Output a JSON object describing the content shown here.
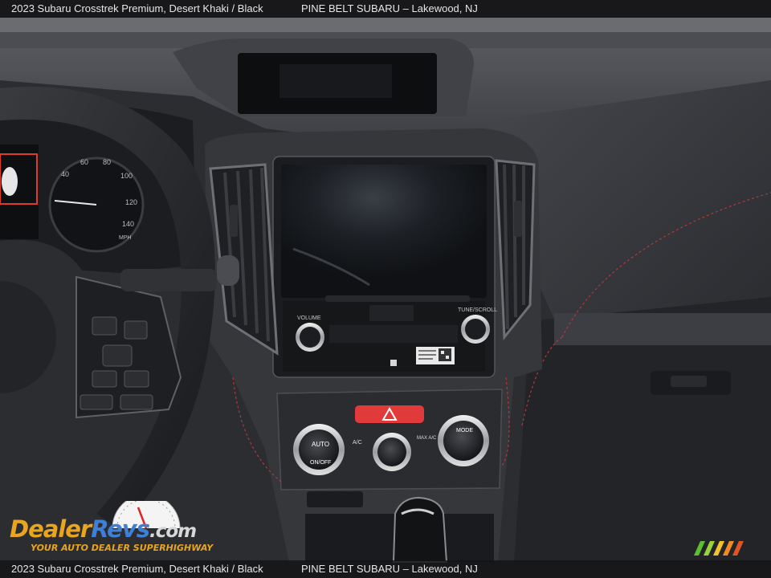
{
  "caption": {
    "vehicle": "2023 Subaru Crosstrek Premium,  Desert Khaki / Black",
    "dealer": "PINE BELT SUBARU – Lakewood, NJ"
  },
  "dashboard": {
    "speedometer_unit": "MPH",
    "speedometer_ticks": [
      "40",
      "60",
      "80",
      "100",
      "120",
      "140"
    ],
    "volume_label": "VOLUME",
    "tune_label": "TUNE/SCROLL",
    "climate_auto_label": "AUTO",
    "climate_onoff_label": "ON/OFF",
    "climate_ac_label": "A/C",
    "climate_max_ac_label": "MAX A/C",
    "climate_mode_label": "MODE"
  },
  "watermark": {
    "brand_part1": "Dealer",
    "brand_part2": "Revs",
    "brand_part3": ".com",
    "tagline": "YOUR AUTO DEALER SUPERHIGHWAY"
  },
  "colors": {
    "dash_dark": "#26272b",
    "dash_mid": "#3a3c41",
    "stitch_red": "#b2383a",
    "hazard_red": "#e13a3a",
    "screen_black": "#121418",
    "watermark_orange": "#e8a51d",
    "watermark_blue": "#3f7fd6"
  }
}
